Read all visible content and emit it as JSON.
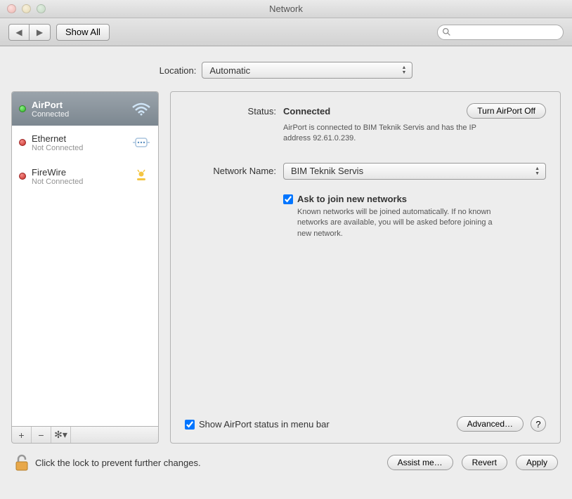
{
  "window": {
    "title": "Network"
  },
  "toolbar": {
    "show_all": "Show All",
    "search_placeholder": ""
  },
  "location": {
    "label": "Location:",
    "value": "Automatic"
  },
  "services": [
    {
      "name": "AirPort",
      "status": "Connected",
      "dot": "green",
      "selected": true
    },
    {
      "name": "Ethernet",
      "status": "Not Connected",
      "dot": "red",
      "selected": false
    },
    {
      "name": "FireWire",
      "status": "Not Connected",
      "dot": "red",
      "selected": false
    }
  ],
  "detail": {
    "status_label": "Status:",
    "status_value": "Connected",
    "turn_off_btn": "Turn AirPort Off",
    "status_info": "AirPort is connected to BIM Teknik Servis and has the IP address 92.61.0.239.",
    "network_name_label": "Network Name:",
    "network_name_value": "BIM Teknik Servis",
    "ask_join_label": "Ask to join new networks",
    "ask_join_desc": "Known networks will be joined automatically. If no known networks are available, you will be asked before joining a new network.",
    "show_status_label": "Show AirPort status in menu bar",
    "advanced_btn": "Advanced…",
    "help_btn": "?"
  },
  "footer": {
    "lock_text": "Click the lock to prevent further changes.",
    "assist_btn": "Assist me…",
    "revert_btn": "Revert",
    "apply_btn": "Apply"
  }
}
